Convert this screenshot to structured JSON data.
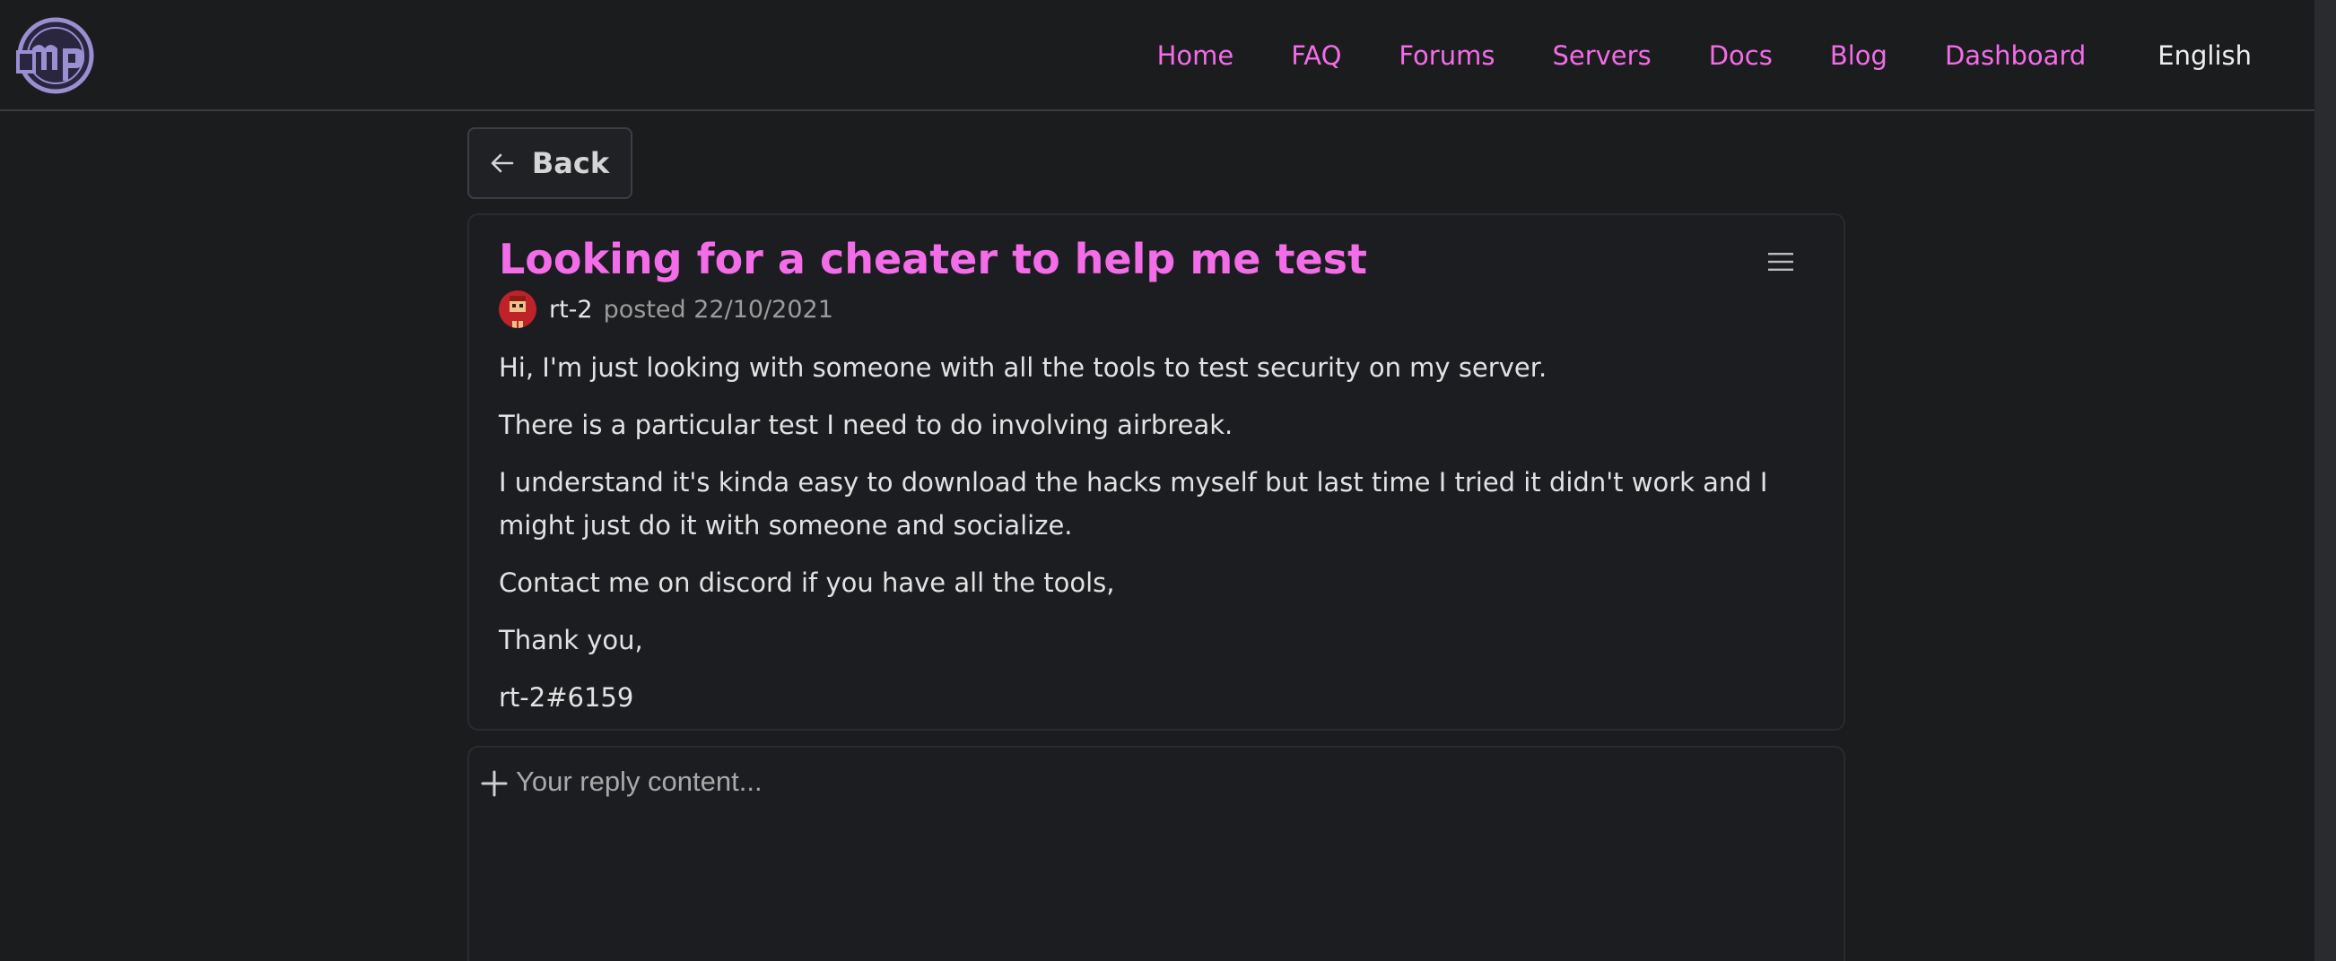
{
  "nav": {
    "items": [
      {
        "label": "Home"
      },
      {
        "label": "FAQ"
      },
      {
        "label": "Forums"
      },
      {
        "label": "Servers"
      },
      {
        "label": "Docs"
      },
      {
        "label": "Blog"
      },
      {
        "label": "Dashboard"
      }
    ],
    "language": "English"
  },
  "back_label": "Back",
  "post": {
    "title": "Looking for a cheater to help me test",
    "author": "rt-2",
    "posted": "posted 22/10/2021",
    "paragraphs": [
      "Hi, I'm just looking with someone with all the tools to test security on my server.",
      "There is a particular test I need to do involving airbreak.",
      "I understand it's kinda easy to download the hacks myself but last time I tried it didn't work and I might just do it with someone and socialize.",
      "Contact me on discord if you have all the tools,",
      "Thank you,",
      "rt-2#6159"
    ]
  },
  "reply": {
    "placeholder": "Your reply content..."
  },
  "colors": {
    "accent": "#f36ce8",
    "background": "#1b1c1e",
    "logo": "#9a8fd0"
  }
}
